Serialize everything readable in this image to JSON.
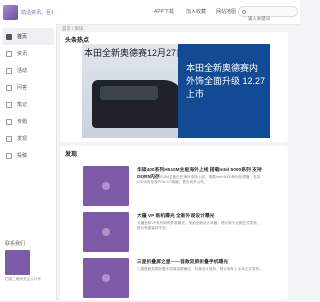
{
  "brand": {
    "name": "前沿资讯，巨省记事!"
  },
  "sidebar": {
    "items": [
      {
        "label": "首页",
        "icon": "home-icon"
      },
      {
        "label": "资讯",
        "icon": "news-icon"
      },
      {
        "label": "活动",
        "icon": "activity-icon"
      },
      {
        "label": "问答",
        "icon": "qa-icon"
      },
      {
        "label": "笔记",
        "icon": "note-icon"
      },
      {
        "label": "专题",
        "icon": "topic-icon"
      },
      {
        "label": "发现",
        "icon": "discover-icon"
      },
      {
        "label": "投稿",
        "icon": "submit-icon"
      }
    ],
    "contact_title": "联系我们",
    "qr_text": "扫描二维码关注公众号"
  },
  "topbar": {
    "links": [
      "APP下载",
      "加入收藏",
      "网站地图"
    ],
    "search_placeholder": "输入关键词"
  },
  "breadcrumb": "首页 / 资讯",
  "headline": {
    "title": "头条热点",
    "slide_left_text": "本田全新奥德赛12月27日上市",
    "slide_right_text": "本田全新奥德赛内外饰全面升级 12.27上市"
  },
  "discover": {
    "title": "发现",
    "articles": [
      {
        "title": "华硕400系列H510M主板海外上线 搭载Intel 5000系列 支持DDR5内存",
        "desc": "华硕400系列H510M主板已在海外市场上线，搭载Intel 5000系列处理器，支持DDR5内存及PCIe 5.0规格，售价尚未公布。"
      },
      {
        "title": "大疆 VP 新机曝光 全新外观设计曝光",
        "desc": "大疆全新VP系列新机外观曝光，采用全新设计风格，预计将于近期正式发布，售价有望保持不变。"
      },
      {
        "title": "三星折叠屏之星——首款双屏折叠手机曝光",
        "desc": "三星首款双屏折叠手机渲染图曝光，机身设计独特，预计明年上半年正式发布。"
      }
    ]
  },
  "colors": {
    "accent": "#7d5aa8",
    "banner_blue": "#124a93"
  }
}
